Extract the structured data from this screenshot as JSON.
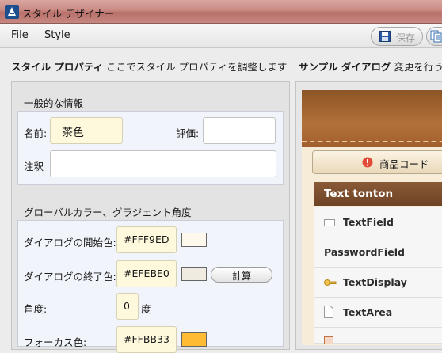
{
  "window": {
    "title": "スタイル デザイナー"
  },
  "menu": {
    "file": "File",
    "style": "Style"
  },
  "toolbar": {
    "save_label": "保存"
  },
  "left_section": {
    "title": "スタイル プロパティ",
    "description": "ここでスタイル プロパティを調整します"
  },
  "right_section": {
    "title": "サンプル ダイアログ",
    "description": "変更を行う"
  },
  "general": {
    "group_title": "一般的な情報",
    "name_label": "名前:",
    "name_value": "茶色",
    "rating_label": "評価:",
    "rating_value": "",
    "note_label": "注釈",
    "note_value": ""
  },
  "colors": {
    "group_title": "グローバルカラー、グラジェント角度",
    "start_label": "ダイアログの開始色:",
    "start_value": "#FFF9ED",
    "start_swatch": "#FFF9ED",
    "end_label": "ダイアログの終了色:",
    "end_value": "#EFEBE0",
    "end_swatch": "#EFEBE0",
    "calc_label": "計算",
    "angle_label": "角度:",
    "angle_value": "0",
    "angle_unit": "度",
    "focus_label": "フォーカス色:",
    "focus_value": "#FFBB33",
    "focus_swatch": "#FFBB33"
  },
  "sample": {
    "product_button": "商品コード",
    "list_title": "Text tonton",
    "items": [
      "TextField",
      "PasswordField",
      "TextDisplay",
      "TextArea"
    ]
  }
}
